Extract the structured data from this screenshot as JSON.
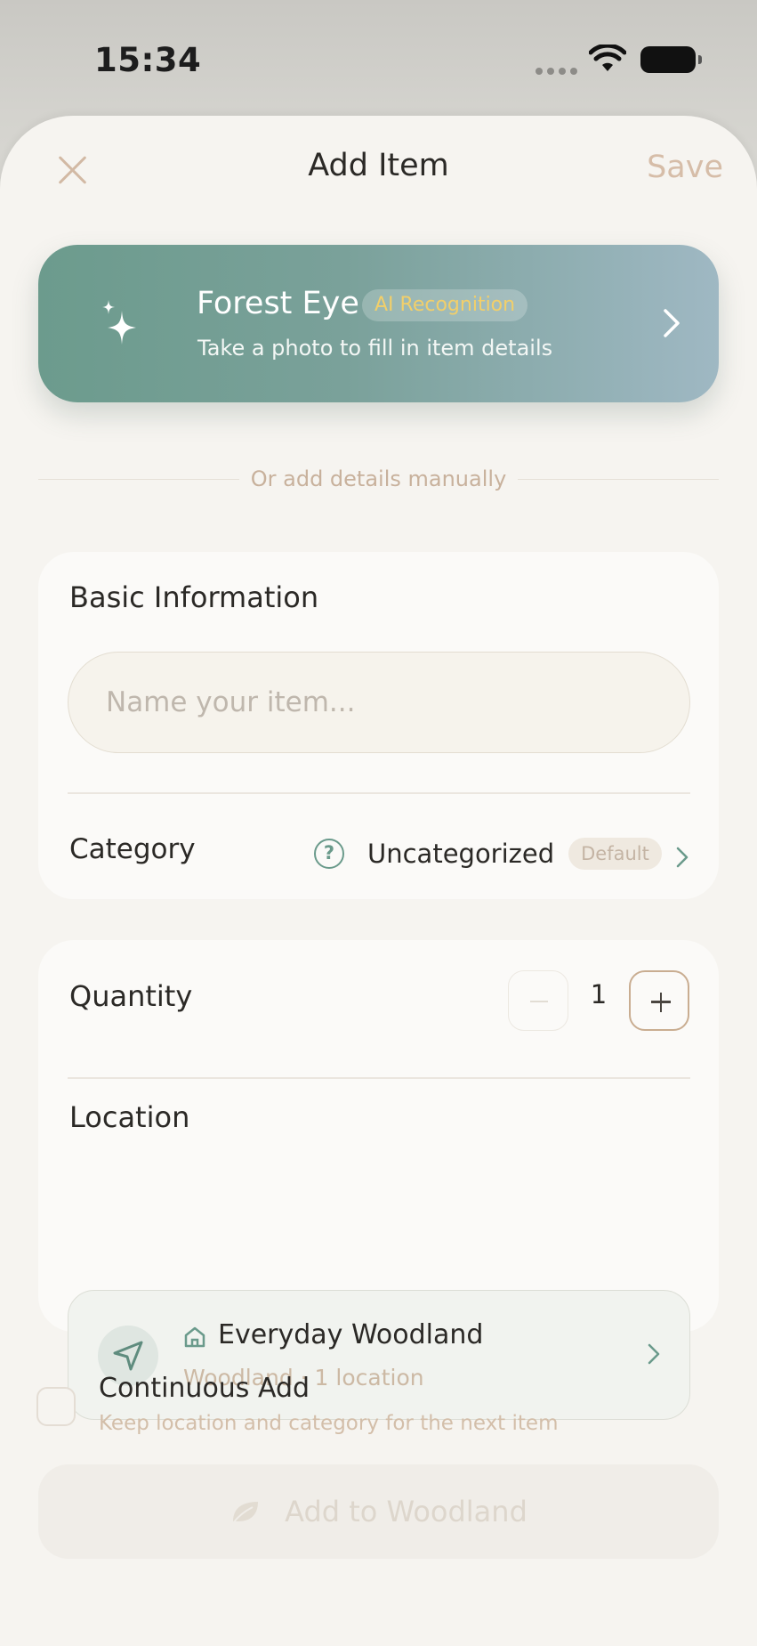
{
  "status_bar": {
    "time": "15:34"
  },
  "header": {
    "title": "Add Item",
    "save_label": "Save"
  },
  "ai_banner": {
    "title": "Forest Eye",
    "badge": "AI Recognition",
    "subtitle": "Take a photo to fill in item details"
  },
  "divider_text": "Or add details manually",
  "basic_info": {
    "section_title": "Basic Information",
    "name_placeholder": "Name your item...",
    "name_value": "",
    "category_label": "Category",
    "category_value": "Uncategorized",
    "category_badge": "Default"
  },
  "quantity": {
    "label": "Quantity",
    "value": "1"
  },
  "location": {
    "label": "Location",
    "name": "Everyday Woodland",
    "subtitle": "Woodland · 1 location"
  },
  "continuous_add": {
    "title": "Continuous Add",
    "subtitle": "Keep location and category for the next item",
    "checked": false
  },
  "submit": {
    "label": "Add to Woodland"
  },
  "colors": {
    "accent_green": "#6a9a8b",
    "accent_tan": "#c9ad91",
    "badge_yellow": "#f2cf6a",
    "sheet_background": "#f6f4f0"
  },
  "icons": [
    "close-icon",
    "sparkle-icon",
    "chevron-right-icon",
    "help-icon",
    "minus-icon",
    "plus-icon",
    "navigation-arrow-icon",
    "house-icon",
    "leaf-icon",
    "wifi-icon",
    "battery-icon"
  ]
}
